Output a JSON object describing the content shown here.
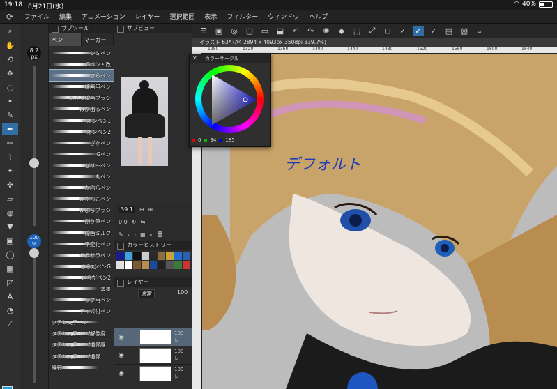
{
  "status": {
    "time": "19:18",
    "date": "8月21日(水)",
    "battery": "40%",
    "battery_level": 0.4
  },
  "menu": [
    "ファイル",
    "編集",
    "アニメーション",
    "レイヤー",
    "選択範囲",
    "表示",
    "フィルター",
    "ウィンドウ",
    "ヘルプ"
  ],
  "toolbox": [
    "zoom-icon",
    "hand-icon",
    "rotate-icon",
    "move-icon",
    "lasso-icon",
    "wand-icon",
    "eyedropper-icon",
    "pen-icon",
    "pencil-icon",
    "brush-icon",
    "airbrush-icon",
    "decoration-icon",
    "eraser-icon",
    "blend-icon",
    "fill-icon",
    "gradient-icon",
    "figure-icon",
    "frame-icon",
    "ruler-icon",
    "text-icon",
    "balloon-icon",
    "line-icon"
  ],
  "brush_size": {
    "value": "8.2",
    "unit": "px",
    "opacity": "100",
    "opacity_unit": "%"
  },
  "subtool": {
    "title": "サブツール",
    "tabs": [
      "ペン",
      "マーカー"
    ],
    "brushes": [
      "シミペン",
      "Gペン・改",
      "さらペン",
      "線画用ペン",
      "めぶく線画ブラシ",
      "ほか出るペン",
      "ネオンペン1",
      "ネオンペン2",
      "ざかペン",
      "Gペン",
      "ゼリーペン",
      "丸ペン",
      "かぶらペン",
      "がたんこペン",
      "かぶらブラシ",
      "割り筆ペン",
      "線画ミルク",
      "平変化ペン",
      "サラサラペン",
      "さらだペンG",
      "きらだペン2",
      "薄墨",
      "ラフ用ペン",
      "アイズ付ペン",
      "タチヒ文字ペン",
      "タチヒ文字ペン/解像度",
      "タチヒ文字ペン/境界線",
      "タチヒ文字ペン/境界",
      "線有"
    ]
  },
  "subview": {
    "title": "サブビュー",
    "zoom": "39.1",
    "angle": "0.0"
  },
  "color_history": {
    "title": "カラーヒストリー",
    "colors": [
      "#1a1a8a",
      "#3fa0e0",
      "#111111",
      "#cccccc",
      "#2a2a2a",
      "#8a7040",
      "#c9a23a",
      "#1f6fd0",
      "#2d5fb0",
      "#e0e0e0",
      "#ffffff",
      "#7a5a30",
      "#b98d4f",
      "#1a4aa0",
      "#222",
      "#555",
      "#3a7a3a",
      "#c33"
    ]
  },
  "layers": {
    "title": "レイヤー",
    "blend": "通常",
    "opacity": "100",
    "rows": [
      {
        "pct": "100",
        "mode": "レ"
      },
      {
        "pct": "100",
        "mode": "レ"
      },
      {
        "pct": "100",
        "mode": "レ"
      }
    ]
  },
  "canvas": {
    "tab": "イラスト 63* (A4 2894 x 4093px 350dpi 339.7%)",
    "ruler": [
      "1280",
      "1320",
      "1360",
      "1400",
      "1440",
      "1480",
      "1520",
      "1560",
      "1600",
      "1640"
    ],
    "handwriting": "デフォルト"
  },
  "color_circle": {
    "title": "カラーサークル",
    "r": "0",
    "g": "34",
    "b": "185"
  }
}
